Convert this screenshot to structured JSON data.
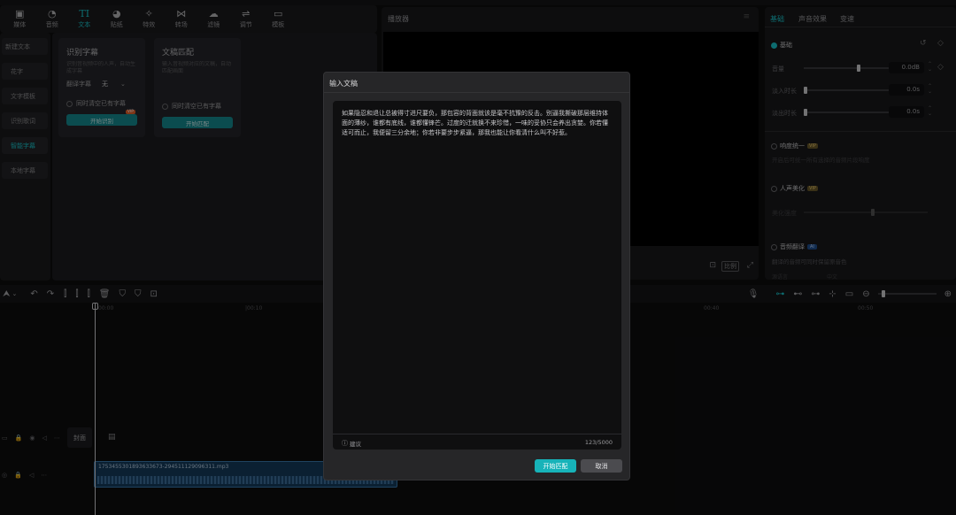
{
  "toolbar": {
    "items": [
      {
        "label": "媒体",
        "icon": "media-icon"
      },
      {
        "label": "音频",
        "icon": "audio-icon"
      },
      {
        "label": "文本",
        "icon": "text-icon"
      },
      {
        "label": "贴纸",
        "icon": "sticker-icon"
      },
      {
        "label": "特效",
        "icon": "effects-icon"
      },
      {
        "label": "转场",
        "icon": "transition-icon"
      },
      {
        "label": "滤镜",
        "icon": "filter-icon"
      },
      {
        "label": "调节",
        "icon": "adjust-icon"
      },
      {
        "label": "模板",
        "icon": "template-icon"
      }
    ],
    "active_index": 2
  },
  "left_nav": {
    "items": [
      "新建文本",
      "花字",
      "文字模板",
      "识别歌词",
      "智能字幕",
      "本地字幕"
    ],
    "active": "智能字幕"
  },
  "cards": {
    "recognize": {
      "title": "识别字幕",
      "desc": "识别音视频中的人声，自动生成字幕",
      "translate_label": "翻译字幕",
      "translate_value": "无",
      "clear_label": "同时清空已有字幕",
      "button": "开始识别",
      "badge": "VIP"
    },
    "match": {
      "title": "文稿匹配",
      "desc": "输入音视频对应的文稿，自动匹配画面",
      "clear_label": "同时清空已有字幕",
      "button": "开始匹配"
    }
  },
  "player": {
    "title": "播放器",
    "ratio_label": "比例"
  },
  "right_panel": {
    "tabs": [
      "基础",
      "声音效果",
      "变速"
    ],
    "active_tab": "基础",
    "basic_label": "基础",
    "volume_label": "音量",
    "volume_value": "0.0dB",
    "fade_in_label": "淡入时长",
    "fade_in_value": "0.0s",
    "fade_out_label": "淡出时长",
    "fade_out_value": "0.0s",
    "loudness_label": "响度统一",
    "loudness_desc": "开启后可统一所有选择的音频片段响度",
    "voice_label": "人声美化",
    "voice_sub": "美化强度",
    "translate_label": "音频翻译",
    "translate_desc": "翻译的音频可同时保留原音色",
    "bottom_label": "源语言",
    "bottom_value": "中文",
    "badge_vip": "VIP",
    "badge_ai": "AI"
  },
  "timeline": {
    "ruler": [
      "00:00",
      "|00:10",
      "00:30",
      "00:40",
      "00:50"
    ],
    "cover_label": "封面",
    "clip_name": "1753455301893633673-294511129096311.mp3"
  },
  "modal": {
    "title": "输入文稿",
    "text": "如果隐忍和退让总被得寸进尺要负，那包容的背面就该是毫不抗豫的反击。别逼我撕破那层维持体面的薄纱，谁都有底线，谁都懂锋芒。过度的迁就换不来珍惜，一味的妥协只会养出贪婪。你若懂适可而止，我便留三分余地；你若非要步步紧逼，那我也能让你看清什么叫不好惹。",
    "hint": "建议",
    "count": "123/5000",
    "confirm": "开始匹配",
    "cancel": "取消"
  },
  "colors": {
    "accent": "#19c5cc",
    "button": "#17b3b9"
  }
}
